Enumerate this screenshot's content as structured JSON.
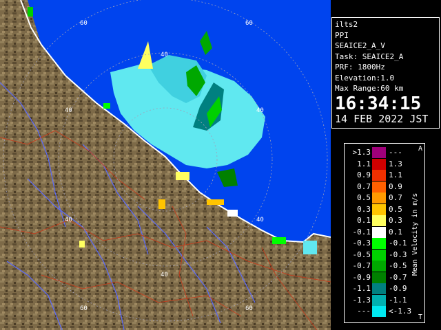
{
  "radar": {
    "site": "ilts2",
    "product": "PPI",
    "scan": "SEAICE2_A_V",
    "task": "Task: SEAICE2_A",
    "prf": "PRF: 1800Hz",
    "elevation": "Elevation:1.0",
    "max_range": "Max Range:60 km",
    "time": "16:34:15",
    "date": "14 FEB 2022 JST"
  },
  "range_labels": [
    "60",
    "40",
    "40",
    "40",
    "40",
    "60",
    "60"
  ],
  "legend": {
    "title": "Mean Velocity in m/s",
    "corner_top": "A",
    "corner_bottom": "T",
    "rows": [
      {
        "lo": ">1.3",
        "hi": "---",
        "color": "#a0007a"
      },
      {
        "lo": "1.1",
        "hi": "1.3",
        "color": "#d00000"
      },
      {
        "lo": "0.9",
        "hi": "1.1",
        "color": "#f03000"
      },
      {
        "lo": "0.7",
        "hi": "0.9",
        "color": "#ff6000"
      },
      {
        "lo": "0.5",
        "hi": "0.7",
        "color": "#ff9a00"
      },
      {
        "lo": "0.3",
        "hi": "0.5",
        "color": "#ffc400"
      },
      {
        "lo": "0.1",
        "hi": "0.3",
        "color": "#ffff60"
      },
      {
        "lo": "-0.1",
        "hi": "0.1",
        "color": "#ffffff"
      },
      {
        "lo": "-0.3",
        "hi": "-0.1",
        "color": "#00ff00"
      },
      {
        "lo": "-0.5",
        "hi": "-0.3",
        "color": "#00d000"
      },
      {
        "lo": "-0.7",
        "hi": "-0.5",
        "color": "#00a800"
      },
      {
        "lo": "-0.9",
        "hi": "-0.7",
        "color": "#008000"
      },
      {
        "lo": "-1.1",
        "hi": "-0.9",
        "color": "#008080"
      },
      {
        "lo": "-1.3",
        "hi": "-1.1",
        "color": "#00b0b0"
      },
      {
        "lo": "---",
        "hi": "<-1.3",
        "color": "#00e8f0"
      }
    ]
  },
  "colors": {
    "sea": "#0044ee",
    "land": "#7d6a48",
    "land_dark": "#4a3c26",
    "echo": "#60e8f0",
    "rings": "#a0a0b8",
    "rivers": "#5a6aff",
    "borders": "#c04020",
    "coast": "#ffffff"
  }
}
